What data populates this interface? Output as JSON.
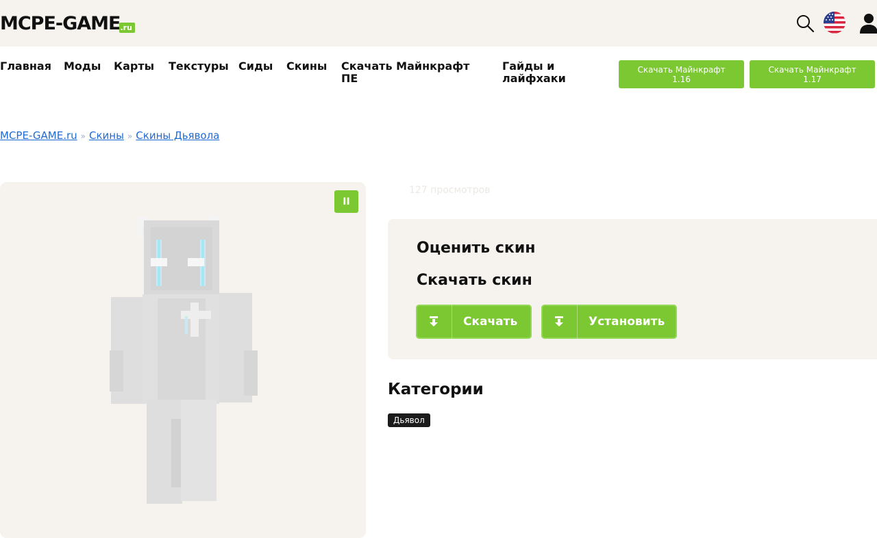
{
  "header": {
    "logo_text": "MCPE-GAME",
    "logo_tld": ".ru",
    "icons": [
      "search-icon",
      "flag-us-icon",
      "user-icon"
    ]
  },
  "nav": {
    "items": [
      {
        "label": "Главная"
      },
      {
        "label": "Моды"
      },
      {
        "label": "Карты"
      },
      {
        "label": "Текстуры"
      },
      {
        "label": "Сиды"
      },
      {
        "label": "Скины"
      },
      {
        "label": "Скачать Майнкрафт ПЕ"
      },
      {
        "label": "Гайды и лайфхаки"
      }
    ],
    "download_buttons": [
      {
        "line1": "Скачать Майнкрафт",
        "line2": "1.16"
      },
      {
        "line1": "Скачать Майнкрафт",
        "line2": "1.17"
      }
    ]
  },
  "breadcrumb": {
    "items": [
      "MCPE-GAME.ru",
      "Скины",
      "Скины Дьявола"
    ],
    "separator": "»"
  },
  "viewer": {
    "pause_label": "II"
  },
  "skin_info": {
    "views": "127 просмотров",
    "rate_title": "Оценить скин",
    "download_title": "Скачать скин",
    "download_button": "Скачать",
    "install_button": "Установить"
  },
  "categories": {
    "title": "Категории",
    "tags": [
      "Дьявол"
    ]
  },
  "colors": {
    "accent": "#7cc832",
    "panel": "#f6f3ee",
    "link": "#1e6bd6",
    "tag_bg": "#1b1b1b"
  }
}
